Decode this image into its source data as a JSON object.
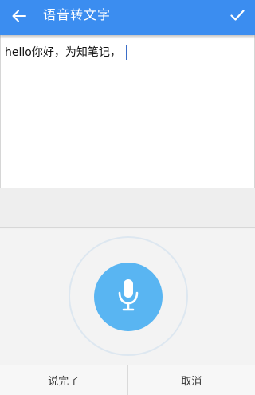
{
  "header": {
    "title": "语音转文字",
    "back_icon": "arrow-left-icon",
    "confirm_icon": "check-icon",
    "color": "#3b8df0"
  },
  "editor": {
    "text": "hello你好，为知笔记，"
  },
  "voice": {
    "mic_icon": "microphone-icon",
    "button_color": "#59b5f2"
  },
  "footer": {
    "done_label": "说完了",
    "cancel_label": "取消"
  }
}
